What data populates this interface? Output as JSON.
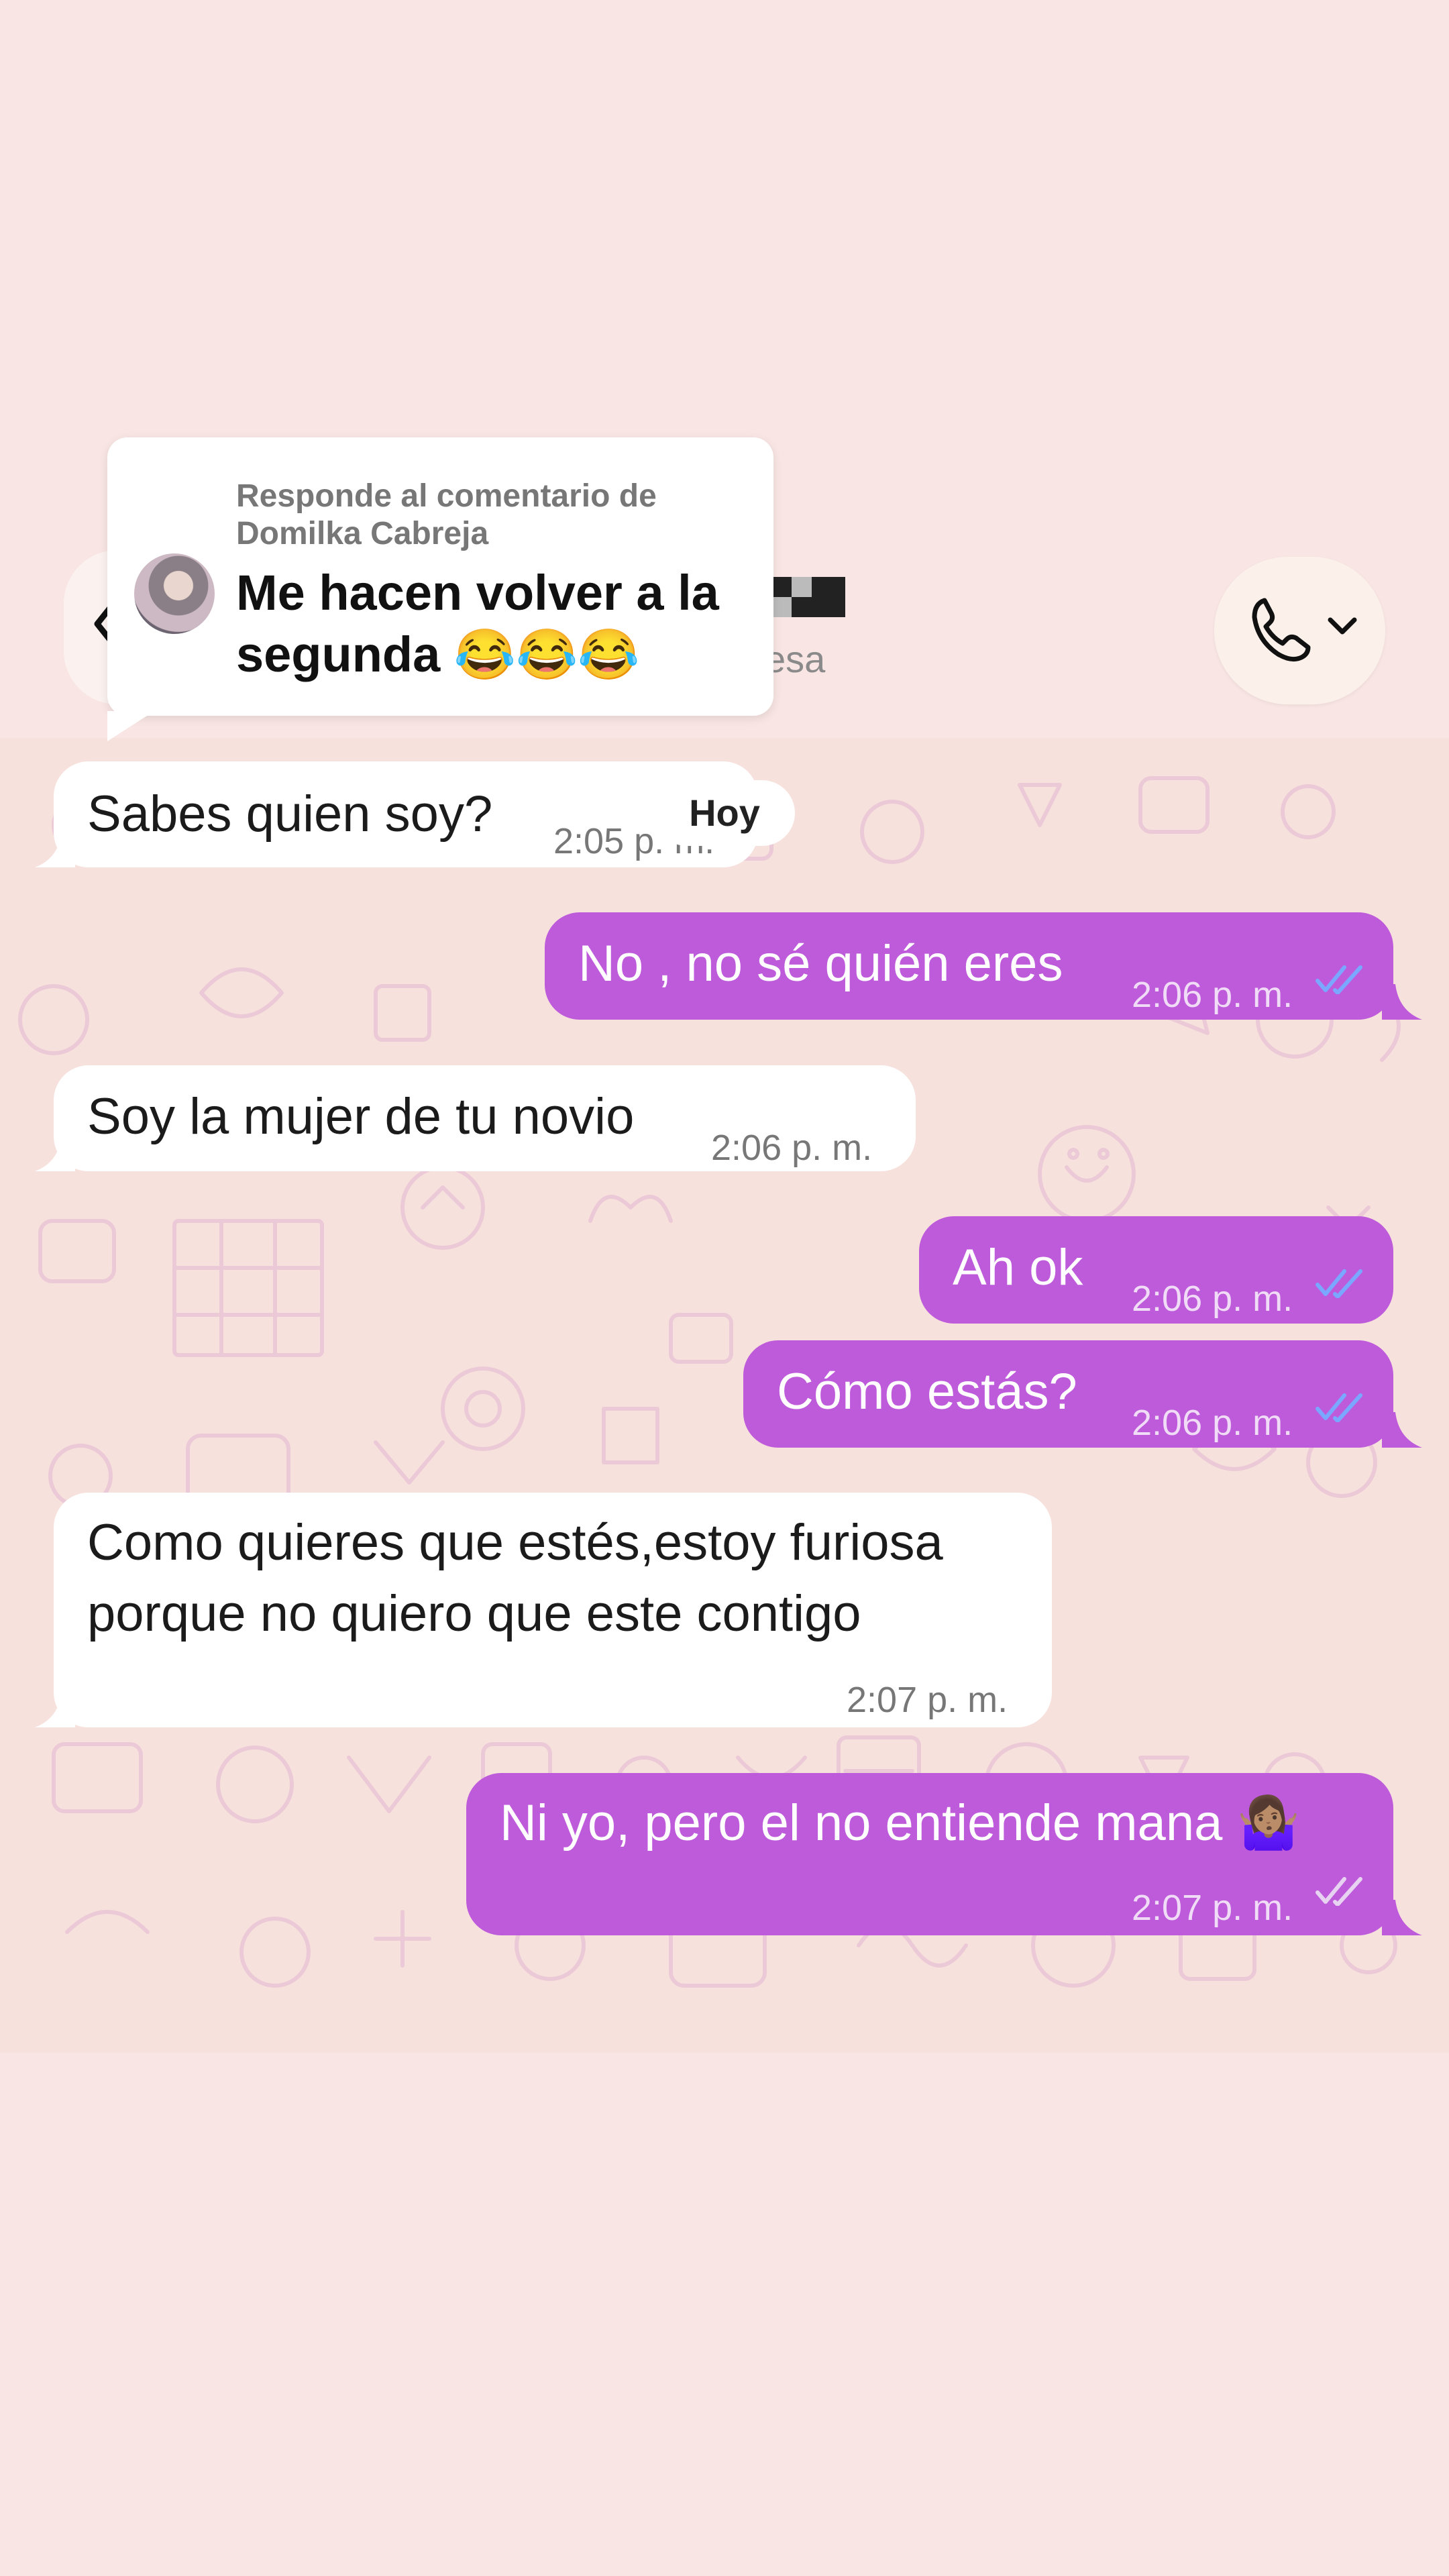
{
  "overlay": {
    "reply_meta": "Responde al comentario de Domilka Cabreja",
    "reply_text": "Me hacen volver a la segunda 😂😂😂"
  },
  "header": {
    "subtitle_fragment": "esa"
  },
  "day_separator": "Hoy",
  "messages": [
    {
      "side": "in",
      "text": "Sabes quien soy?",
      "time": "2:05 p. m."
    },
    {
      "side": "out",
      "text": "No , no sé quién eres",
      "time": "2:06 p. m."
    },
    {
      "side": "in",
      "text": "Soy la mujer de tu novio",
      "time": "2:06 p. m."
    },
    {
      "side": "out",
      "text": "Ah ok",
      "time": "2:06 p. m."
    },
    {
      "side": "out",
      "text": "Cómo estás?",
      "time": "2:06 p. m."
    },
    {
      "side": "in",
      "text_lines": [
        "Como quieres que estés,estoy furiosa",
        "porque no quiero que este contigo"
      ],
      "time": "2:07 p. m."
    },
    {
      "side": "out",
      "text": "Ni yo, pero el no entiende mana 🤷🏽‍♀️",
      "time": "2:07 p. m."
    }
  ],
  "colors": {
    "page_bg": "#f9e6e4",
    "chat_bg": "#f7e1dd",
    "outgoing_bubble": "#be5bdb",
    "incoming_bubble": "#ffffff",
    "read_ticks": "#7aa7ff"
  },
  "icons": [
    "back-chevron-icon",
    "phone-icon",
    "chevron-down-icon",
    "double-check-icon"
  ]
}
